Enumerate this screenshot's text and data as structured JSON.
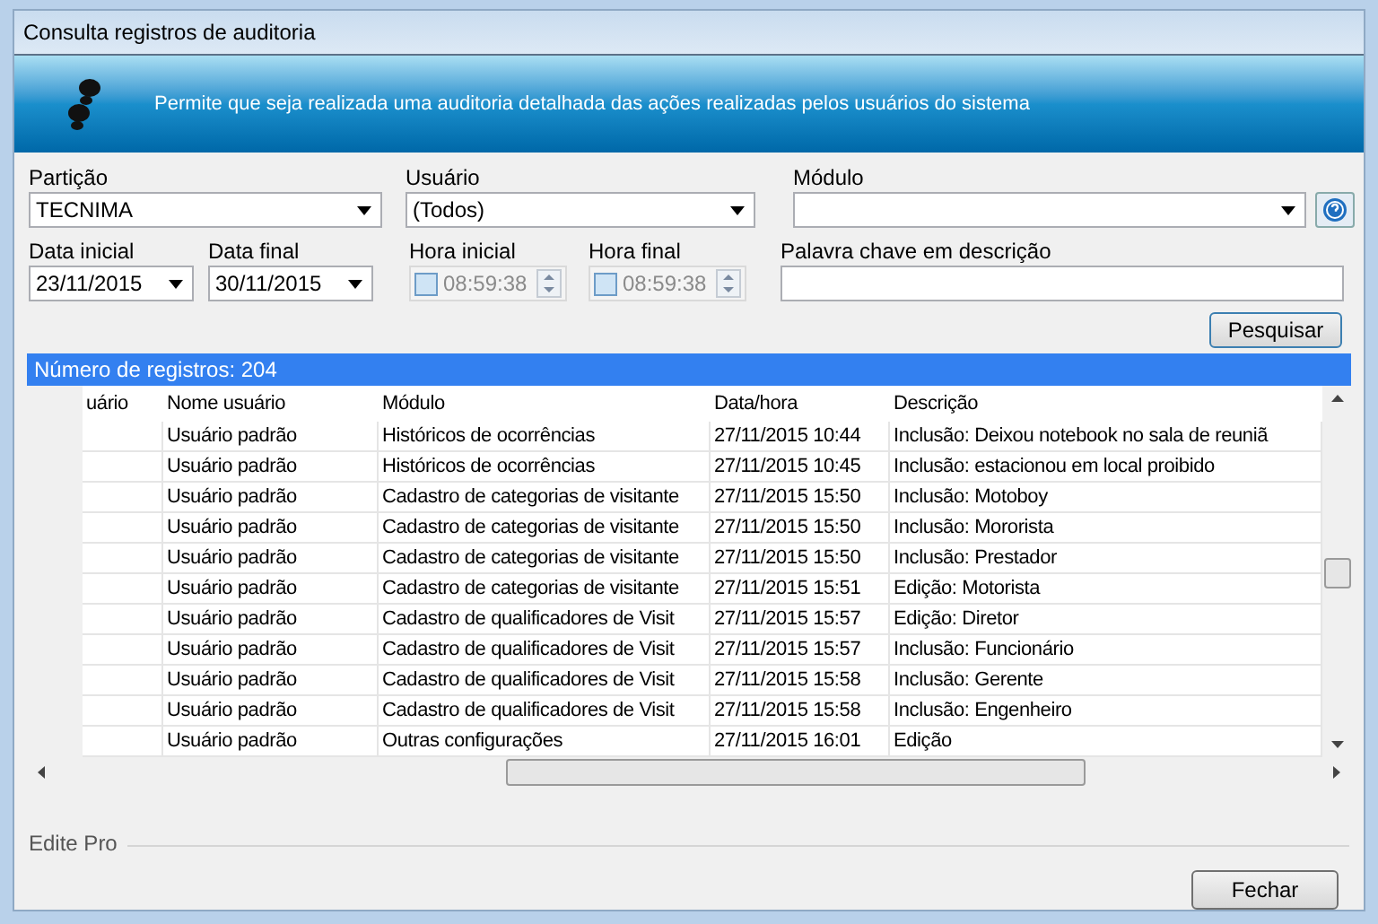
{
  "window": {
    "title": "Consulta registros de auditoria"
  },
  "banner": {
    "text": "Permite que seja realizada uma auditoria detalhada das ações realizadas pelos usuários do sistema"
  },
  "filters": {
    "particao": {
      "label": "Partição",
      "value": "TECNIMA"
    },
    "usuario": {
      "label": "Usuário",
      "value": "(Todos)"
    },
    "modulo": {
      "label": "Módulo"
    },
    "data_inicial": {
      "label": "Data inicial",
      "value": "23/11/2015"
    },
    "data_final": {
      "label": "Data final",
      "value": "30/11/2015"
    },
    "hora_inicial": {
      "label": "Hora inicial",
      "value": "08:59:38",
      "checked": false
    },
    "hora_final": {
      "label": "Hora final",
      "value": "08:59:38",
      "checked": false
    },
    "palavra_chave": {
      "label": "Palavra chave em descrição"
    },
    "search_button": "Pesquisar"
  },
  "results": {
    "count_label": "Número de registros: 204",
    "columns": [
      "uário",
      "Nome usuário",
      "Módulo",
      "Data/hora",
      "Descrição"
    ],
    "rows": [
      [
        "",
        "Usuário padrão",
        "Históricos de ocorrências",
        "27/11/2015 10:44",
        "Inclusão: Deixou notebook no sala de reuniã"
      ],
      [
        "",
        "Usuário padrão",
        "Históricos de ocorrências",
        "27/11/2015 10:45",
        "Inclusão: estacionou em local proibido"
      ],
      [
        "",
        "Usuário padrão",
        "Cadastro de categorias de visitante",
        "27/11/2015 15:50",
        "Inclusão: Motoboy"
      ],
      [
        "",
        "Usuário padrão",
        "Cadastro de categorias de visitante",
        "27/11/2015 15:50",
        "Inclusão: Mororista"
      ],
      [
        "",
        "Usuário padrão",
        "Cadastro de categorias de visitante",
        "27/11/2015 15:50",
        "Inclusão: Prestador"
      ],
      [
        "",
        "Usuário padrão",
        "Cadastro de categorias de visitante",
        "27/11/2015 15:51",
        "Edição: Motorista"
      ],
      [
        "",
        "Usuário padrão",
        "Cadastro de qualificadores de Visit",
        "27/11/2015 15:57",
        "Edição: Diretor"
      ],
      [
        "",
        "Usuário padrão",
        "Cadastro de qualificadores de Visit",
        "27/11/2015 15:57",
        "Inclusão: Funcionário"
      ],
      [
        "",
        "Usuário padrão",
        "Cadastro de qualificadores de Visit",
        "27/11/2015 15:58",
        "Inclusão: Gerente"
      ],
      [
        "",
        "Usuário padrão",
        "Cadastro de qualificadores de Visit",
        "27/11/2015 15:58",
        "Inclusão: Engenheiro"
      ],
      [
        "",
        "Usuário padrão",
        "Outras configurações",
        "27/11/2015 16:01",
        "Edição"
      ]
    ]
  },
  "footer": {
    "group_label": "Edite Pro",
    "close_button": "Fechar"
  }
}
